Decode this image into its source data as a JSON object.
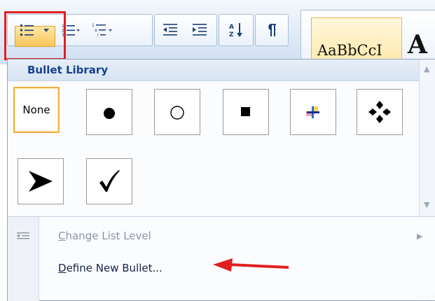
{
  "ribbon": {
    "buttons": [
      {
        "name": "bullets-button",
        "icon": "bullets-icon"
      },
      {
        "name": "numbering-button",
        "icon": "numbering-icon"
      },
      {
        "name": "multilevel-list-button",
        "icon": "multilevel-list-icon"
      },
      {
        "name": "decrease-indent-button",
        "icon": "decrease-indent-icon"
      },
      {
        "name": "increase-indent-button",
        "icon": "increase-indent-icon"
      },
      {
        "name": "sort-button",
        "icon": "sort-az-icon"
      },
      {
        "name": "show-formatting-button",
        "icon": "pilcrow-icon"
      }
    ],
    "style_preview": "AaBbCcI",
    "style_next_glyph": "A"
  },
  "bullet_library": {
    "title": "Bullet Library",
    "items": [
      {
        "label": "None",
        "icon": "none",
        "selected": true
      },
      {
        "label": "",
        "icon": "filled-circle-bullet-icon",
        "selected": false
      },
      {
        "label": "",
        "icon": "hollow-circle-bullet-icon",
        "selected": false
      },
      {
        "label": "",
        "icon": "filled-square-bullet-icon",
        "selected": false
      },
      {
        "label": "",
        "icon": "colored-cross-bullet-icon",
        "selected": false
      },
      {
        "label": "",
        "icon": "four-diamond-bullet-icon",
        "selected": false
      },
      {
        "label": "",
        "icon": "arrowhead-bullet-icon",
        "selected": false
      },
      {
        "label": "",
        "icon": "checkmark-bullet-icon",
        "selected": false
      }
    ]
  },
  "menu": {
    "change_list_level": "Change List Level",
    "define_new_bullet": "Define New Bullet..."
  },
  "colors": {
    "highlight": "#e02020",
    "selected_border": "#f0b041",
    "header_text": "#15428b",
    "annotation_arrow": "#e02020"
  }
}
